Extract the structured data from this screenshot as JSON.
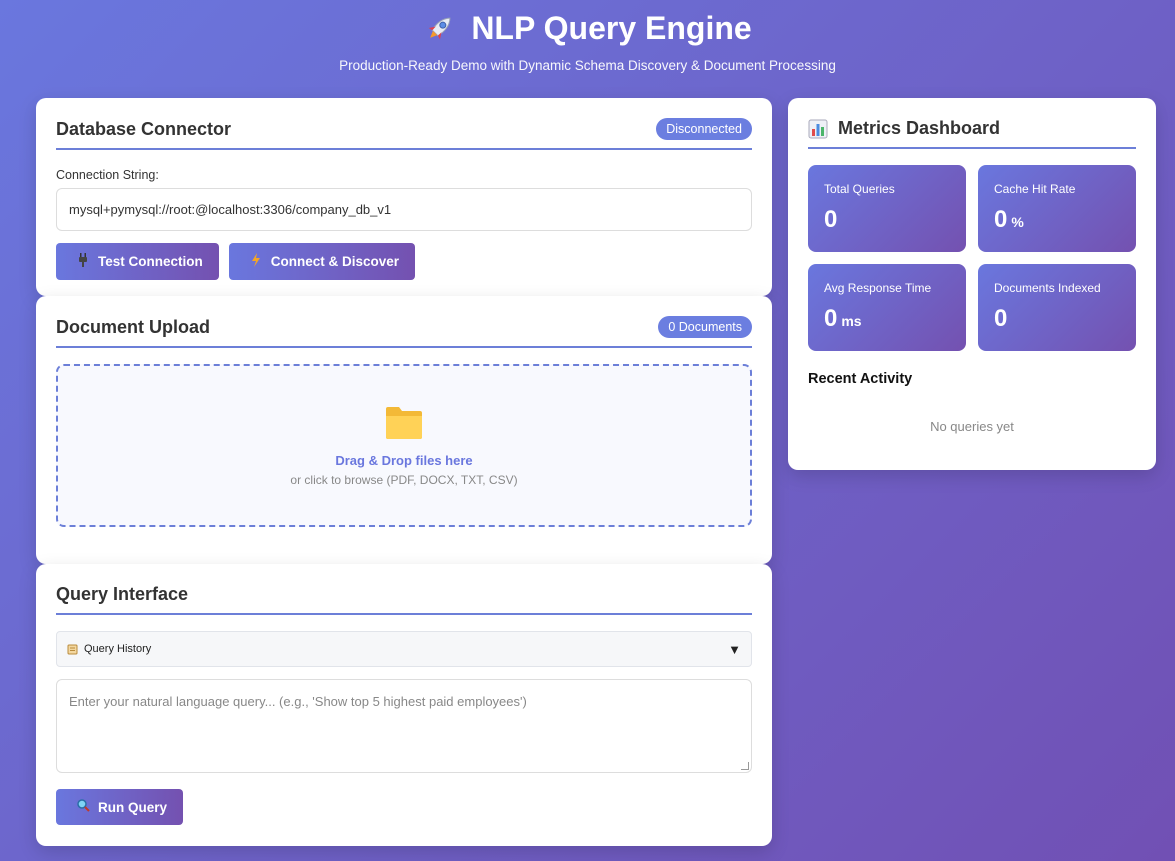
{
  "header": {
    "title": "NLP Query Engine",
    "subtitle": "Production-Ready Demo with Dynamic Schema Discovery & Document Processing"
  },
  "db": {
    "title": "Database Connector",
    "status": "Disconnected",
    "conn_label": "Connection String:",
    "conn_value": "mysql+pymysql://root:@localhost:3306/company_db_v1",
    "test_label": "Test Connection",
    "connect_label": "Connect & Discover"
  },
  "upload": {
    "title": "Document Upload",
    "count": "0 Documents",
    "drop_title": "Drag & Drop files here",
    "drop_sub": "or click to browse (PDF, DOCX, TXT, CSV)"
  },
  "query": {
    "title": "Query Interface",
    "history_label": "Query History",
    "history_arrow": "▼",
    "placeholder": "Enter your natural language query... (e.g., 'Show top 5 highest paid employees')",
    "run_label": "Run Query"
  },
  "metrics": {
    "title": "Metrics Dashboard",
    "items": [
      {
        "label": "Total Queries",
        "value": "0",
        "unit": ""
      },
      {
        "label": "Cache Hit Rate",
        "value": "0",
        "unit": "%"
      },
      {
        "label": "Avg Response Time",
        "value": "0",
        "unit": "ms"
      },
      {
        "label": "Documents Indexed",
        "value": "0",
        "unit": ""
      }
    ],
    "recent_title": "Recent Activity",
    "recent_empty": "No queries yet"
  },
  "colors": {
    "accent": "#6a77de",
    "accent_end": "#7451b0"
  }
}
